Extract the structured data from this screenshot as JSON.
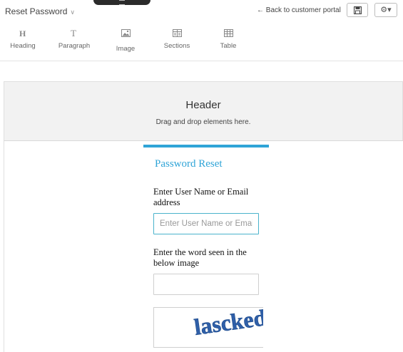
{
  "topbar": {
    "page_name": "Reset Password",
    "back_link": "← Back to customer portal",
    "gear_caret": "▾"
  },
  "toolbar": {
    "tools": [
      {
        "label": "Heading",
        "icon": "heading-icon"
      },
      {
        "label": "Paragraph",
        "icon": "paragraph-icon"
      },
      {
        "label": "Image",
        "icon": "image-icon"
      },
      {
        "label": "Sections",
        "icon": "sections-icon"
      },
      {
        "label": "Table",
        "icon": "table-icon"
      }
    ]
  },
  "canvas": {
    "header_title": "Header",
    "header_subtitle": "Drag and drop elements here."
  },
  "form": {
    "title": "Password Reset",
    "username_label": "Enter User Name or Email address",
    "username_placeholder": "Enter User Name or Email",
    "captcha_label": "Enter the word seen in the below image",
    "captcha_word": "lascked"
  },
  "colors": {
    "accent": "#2fa4d7",
    "input_focus_border": "#4ab3cc",
    "captcha_text": "#2f5fa8"
  }
}
